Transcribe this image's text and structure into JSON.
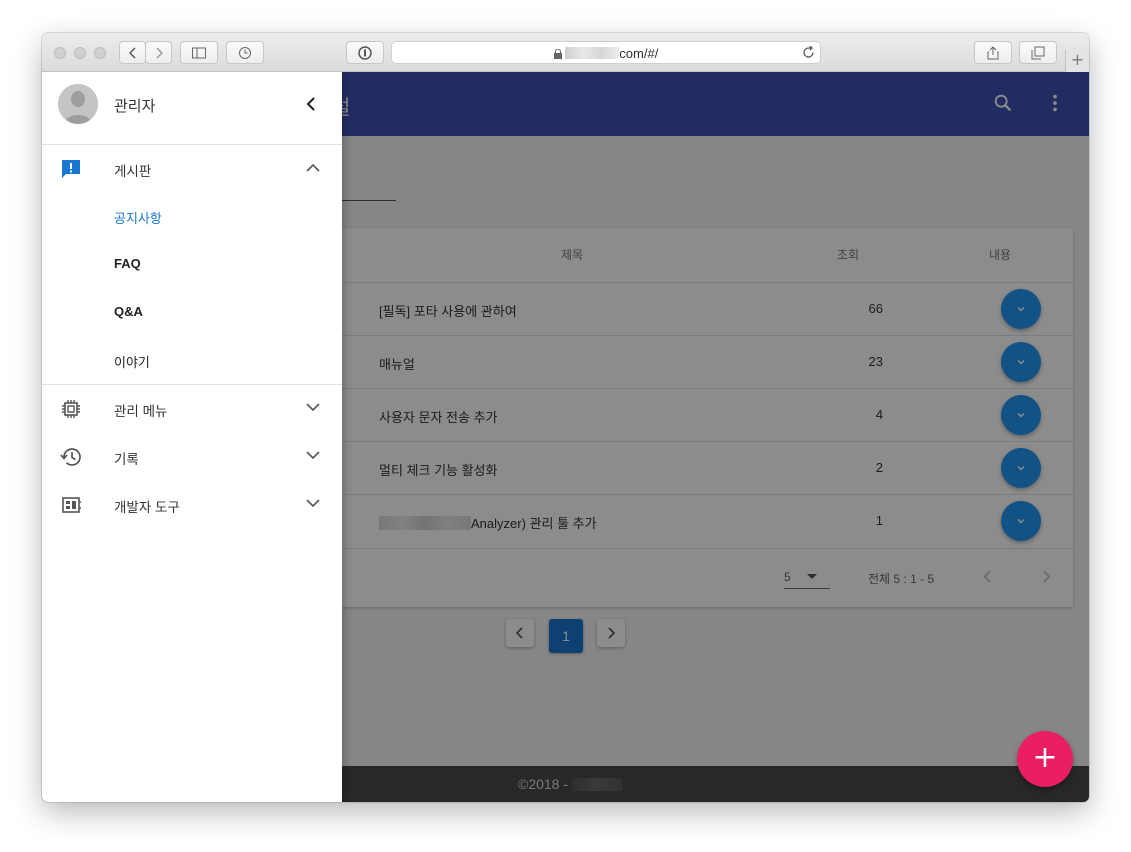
{
  "browser": {
    "url_suffix": "com/#/"
  },
  "drawer": {
    "user_name": "관리자",
    "menu": [
      {
        "label": "게시판",
        "icon": "feedback-icon"
      },
      {
        "label": "관리 메뉴",
        "icon": "chip-icon"
      },
      {
        "label": "기록",
        "icon": "history-icon"
      },
      {
        "label": "개발자 도구",
        "icon": "dashboard-icon"
      }
    ],
    "board_sub": [
      {
        "label": "공지사항",
        "active": true
      },
      {
        "label": "FAQ"
      },
      {
        "label": "Q&A"
      },
      {
        "label": "이야기"
      }
    ]
  },
  "appbar": {
    "title_fragment": "털"
  },
  "table": {
    "headers": {
      "title": "제목",
      "views": "조회",
      "content": "내용"
    },
    "rows": [
      {
        "title": "[필독] 포타 사용에 관하여",
        "views": "66"
      },
      {
        "title": "매뉴얼",
        "views": "23"
      },
      {
        "title": "사용자 문자 전송 추가",
        "views": "4"
      },
      {
        "title": "멀티 체크 기능 활성화",
        "views": "2"
      },
      {
        "title": "Analyzer) 관리 툴 추가",
        "views": "1"
      }
    ],
    "rows_per_page": "5",
    "range_text": "전체 5 : 1 - 5"
  },
  "pagination": {
    "current": "1"
  },
  "footer": {
    "copyright": "©2018 -"
  },
  "colors": {
    "appbar": "#3f51b5",
    "accent": "#1976d2",
    "fab": "#e91e63",
    "row_button": "#2196f3"
  }
}
